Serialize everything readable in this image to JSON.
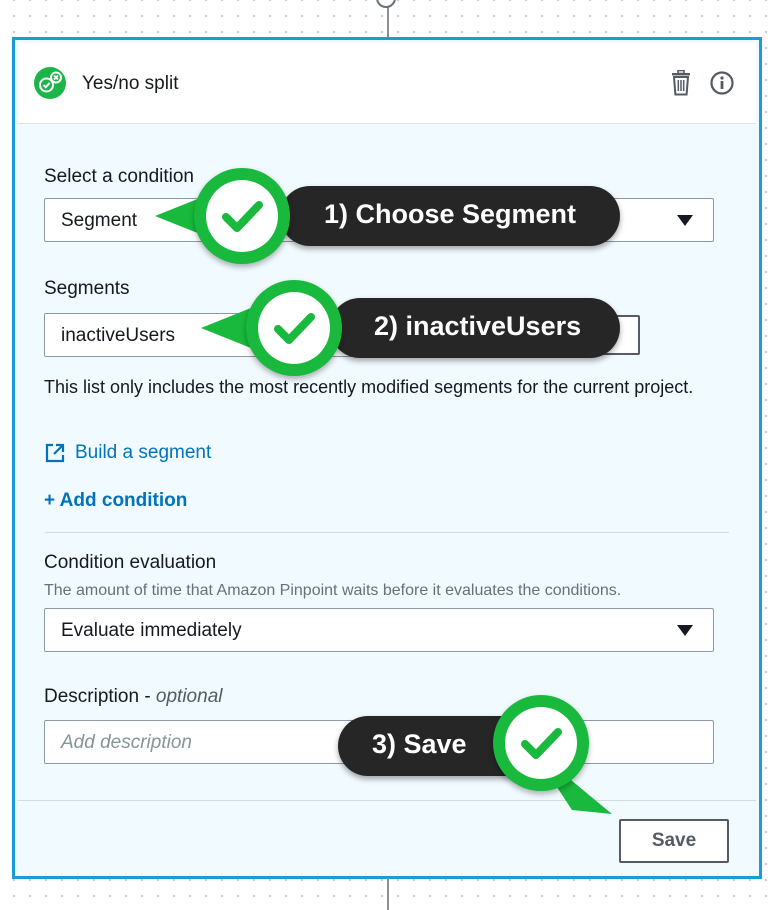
{
  "card": {
    "title": "Yes/no split",
    "icons": {
      "split": "yes-no-split-icon",
      "trash": "trash-icon",
      "info": "info-icon"
    }
  },
  "condition": {
    "label": "Select a condition",
    "value": "Segment"
  },
  "segments": {
    "label": "Segments",
    "value": "inactiveUsers",
    "help": "This list only includes the most recently modified segments for the current project.",
    "build_link": "Build a segment",
    "add_condition": "+ Add condition"
  },
  "evaluation": {
    "label": "Condition evaluation",
    "hint": "The amount of time that Amazon Pinpoint waits before it evaluates the conditions.",
    "value": "Evaluate immediately"
  },
  "description": {
    "label": "Description - ",
    "optional": "optional",
    "placeholder": "Add description"
  },
  "save_label": "Save",
  "callouts": {
    "step1": "1) Choose Segment",
    "step2": "2) inactiveUsers",
    "step3": "3) Save"
  },
  "colors": {
    "accent_border": "#1a9cd6",
    "link": "#0073bb",
    "callout_green": "#18b93d",
    "callout_dark": "#262626"
  }
}
